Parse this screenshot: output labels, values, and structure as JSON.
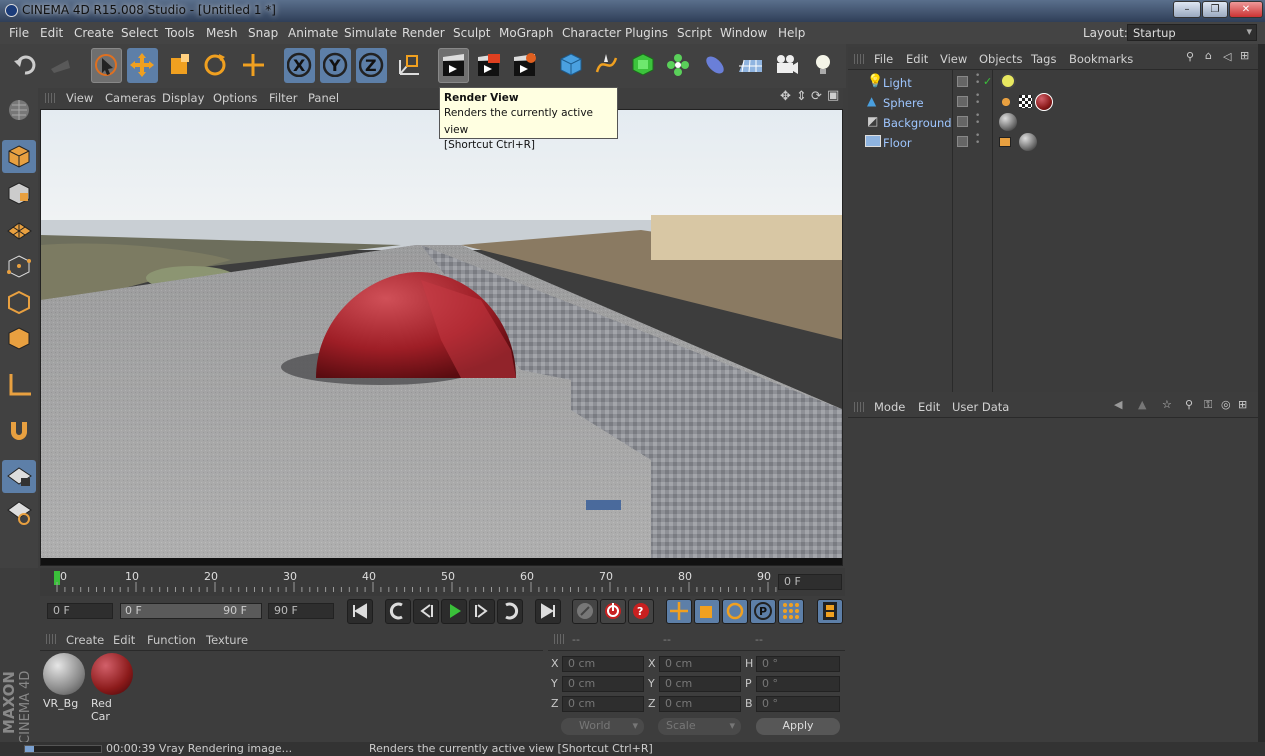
{
  "window": {
    "title": "CINEMA 4D R15.008 Studio - [Untitled 1 *]",
    "controls": [
      "minimize",
      "restore",
      "close"
    ]
  },
  "menubar": {
    "items": [
      "File",
      "Edit",
      "Create",
      "Select",
      "Tools",
      "Mesh",
      "Snap",
      "Animate",
      "Simulate",
      "Render",
      "Sculpt",
      "MoGraph",
      "Character",
      "Plugins",
      "Script",
      "Window",
      "Help"
    ],
    "layout_label": "Layout:",
    "layout_value": "Startup"
  },
  "tooltip": {
    "title": "Render View",
    "line1": "Renders the currently active view",
    "line2": "[Shortcut Ctrl+R]"
  },
  "viewport_menu": {
    "items": [
      "View",
      "Cameras",
      "Display",
      "Options",
      "Filter",
      "Panel"
    ]
  },
  "timeline": {
    "ticks": [
      "0",
      "10",
      "20",
      "30",
      "40",
      "50",
      "60",
      "70",
      "80",
      "90"
    ],
    "current_frame": "0 F"
  },
  "transport": {
    "start_field": "0 F",
    "range_min": "0 F",
    "range_max": "90 F",
    "end_field": "90 F"
  },
  "material_manager": {
    "menu": [
      "Create",
      "Edit",
      "Function",
      "Texture"
    ],
    "materials": [
      {
        "name": "VR_Bg",
        "color": "#8a8a8a"
      },
      {
        "name": "Red Car",
        "color": "#8b1a1a"
      }
    ]
  },
  "coordinates": {
    "headers": [
      "--",
      "--",
      "--"
    ],
    "rows": [
      {
        "a": "X",
        "av": "0 cm",
        "b": "X",
        "bv": "0 cm",
        "c": "H",
        "cv": "0 °"
      },
      {
        "a": "Y",
        "av": "0 cm",
        "b": "Y",
        "bv": "0 cm",
        "c": "P",
        "cv": "0 °"
      },
      {
        "a": "Z",
        "av": "0 cm",
        "b": "Z",
        "bv": "0 cm",
        "c": "B",
        "cv": "0 °"
      }
    ],
    "mode": "World",
    "size_mode": "Scale",
    "apply": "Apply"
  },
  "object_manager": {
    "menu": [
      "File",
      "Edit",
      "View",
      "Objects",
      "Tags",
      "Bookmarks"
    ],
    "objects": [
      {
        "name": "Light"
      },
      {
        "name": "Sphere"
      },
      {
        "name": "Background"
      },
      {
        "name": "Floor"
      }
    ]
  },
  "attribute_manager": {
    "menu": [
      "Mode",
      "Edit",
      "User Data"
    ]
  },
  "status": {
    "progress_text": "00:00:39 Vray Rendering image...",
    "progress_fraction": 0.12,
    "help_text": "Renders the currently active view [Shortcut Ctrl+R]"
  },
  "brand": {
    "maxon": "MAXON",
    "cinema": "CINEMA 4D"
  },
  "colors": {
    "accent": "#5d7fa8",
    "object_name": "#9ec6ff",
    "sky": "#e8edf1",
    "road": "#9a9a9a",
    "sphere": "#9e1e26"
  }
}
